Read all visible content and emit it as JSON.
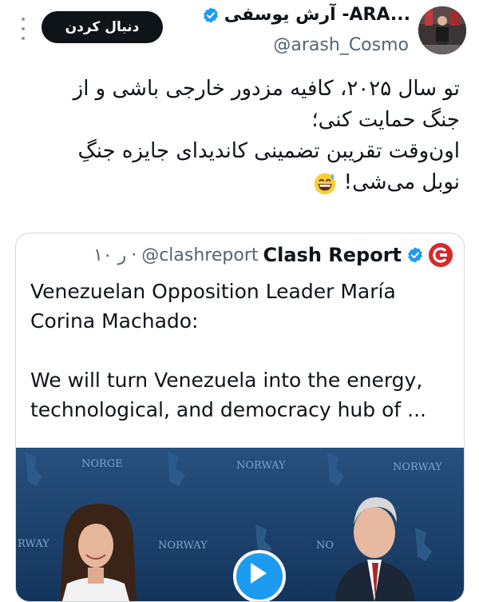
{
  "author": {
    "display_name": "آرش یوسفی -ARA...",
    "handle": "@arash_Cosmo",
    "follow_label": "دنبال کردن"
  },
  "tweet": {
    "lines": [
      "تو سال ۲۰۲۵، کافیه مزدور خارجی باشی و از",
      "جنگ حمایت کنی؛",
      "اون‌وقت تقریبن تضمینی کاندیدای جایزه جنگِ",
      "نوبل می‌شی!"
    ],
    "emoji": "grinning-sweat-emoji"
  },
  "quote": {
    "name": "Clash Report",
    "handle": "@clashreport",
    "time": "۱۰ ر",
    "text_lines": [
      "Venezuelan Opposition Leader María",
      "Corina Machado:",
      "",
      "We will turn Venezuela into the energy,",
      "technological, and democracy hub of ..."
    ],
    "media": {
      "backdrop_labels": [
        "NORGE",
        "NORWAY",
        "NORWAY",
        "RWAY",
        "NORWAY",
        "NO"
      ]
    }
  },
  "colors": {
    "verified": "#1d9bf0",
    "text": "#0f1419",
    "secondary": "#536471",
    "backdrop": "#1e3f66"
  }
}
